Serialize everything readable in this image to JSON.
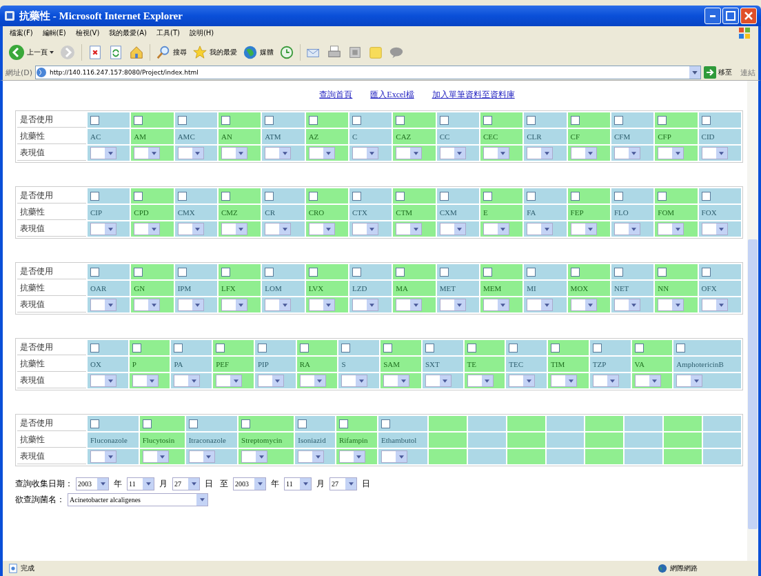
{
  "window": {
    "title": "抗藥性 - Microsoft Internet Explorer"
  },
  "menu": [
    "檔案(F)",
    "編輯(E)",
    "檢視(V)",
    "我的最愛(A)",
    "工具(T)",
    "說明(H)"
  ],
  "toolbar": {
    "back": "上一頁",
    "search": "搜尋",
    "favorites": "我的最愛",
    "media": "媒體"
  },
  "address": {
    "label": "網址(D)",
    "url": "http://140.116.247.157:8080/Project/index.html",
    "go": "移至",
    "links": "連結"
  },
  "nav_links": [
    "查詢首頁",
    "匯入Excel檔",
    "加入單筆資料至資料庫"
  ],
  "tables": [
    {
      "labels": [
        "是否使用",
        "抗藥性",
        "表現值"
      ],
      "columns": [
        {
          "kind": "drug",
          "name": "AC",
          "checked": false
        },
        {
          "kind": "drug",
          "name": "AM",
          "checked": false
        },
        {
          "kind": "drug",
          "name": "AMC",
          "checked": false
        },
        {
          "kind": "drug",
          "name": "AN",
          "checked": false
        },
        {
          "kind": "drug",
          "name": "ATM",
          "checked": false
        },
        {
          "kind": "drug",
          "name": "AZ",
          "checked": false
        },
        {
          "kind": "drug",
          "name": "C",
          "checked": false
        },
        {
          "kind": "drug",
          "name": "CAZ",
          "checked": false
        },
        {
          "kind": "drug",
          "name": "CC",
          "checked": false
        },
        {
          "kind": "drug",
          "name": "CEC",
          "checked": false
        },
        {
          "kind": "drug",
          "name": "CLR",
          "checked": false
        },
        {
          "kind": "drug",
          "name": "CF",
          "checked": false
        },
        {
          "kind": "drug",
          "name": "CFM",
          "checked": false
        },
        {
          "kind": "drug",
          "name": "CFP",
          "checked": false
        },
        {
          "kind": "drug",
          "name": "CID",
          "checked": false
        }
      ]
    },
    {
      "labels": [
        "是否使用",
        "抗藥性",
        "表現值"
      ],
      "columns": [
        {
          "kind": "drug",
          "name": "CIP",
          "checked": false
        },
        {
          "kind": "drug",
          "name": "CPD",
          "checked": false
        },
        {
          "kind": "drug",
          "name": "CMX",
          "checked": false
        },
        {
          "kind": "drug",
          "name": "CMZ",
          "checked": false
        },
        {
          "kind": "drug",
          "name": "CR",
          "checked": false
        },
        {
          "kind": "drug",
          "name": "CRO",
          "checked": false
        },
        {
          "kind": "drug",
          "name": "CTX",
          "checked": false
        },
        {
          "kind": "drug",
          "name": "CTM",
          "checked": false
        },
        {
          "kind": "drug",
          "name": "CXM",
          "checked": false
        },
        {
          "kind": "drug",
          "name": "E",
          "checked": false
        },
        {
          "kind": "drug",
          "name": "FA",
          "checked": false
        },
        {
          "kind": "drug",
          "name": "FEP",
          "checked": false
        },
        {
          "kind": "drug",
          "name": "FLO",
          "checked": false
        },
        {
          "kind": "drug",
          "name": "FOM",
          "checked": false
        },
        {
          "kind": "drug",
          "name": "FOX",
          "checked": false
        }
      ]
    },
    {
      "labels": [
        "是否使用",
        "抗藥性",
        "表現值"
      ],
      "columns": [
        {
          "kind": "drug",
          "name": "OAR",
          "checked": false
        },
        {
          "kind": "drug",
          "name": "GN",
          "checked": false
        },
        {
          "kind": "drug",
          "name": "IPM",
          "checked": false
        },
        {
          "kind": "drug",
          "name": "LFX",
          "checked": false
        },
        {
          "kind": "drug",
          "name": "LOM",
          "checked": false
        },
        {
          "kind": "drug",
          "name": "LVX",
          "checked": false
        },
        {
          "kind": "drug",
          "name": "LZD",
          "checked": false
        },
        {
          "kind": "drug",
          "name": "MA",
          "checked": false
        },
        {
          "kind": "drug",
          "name": "MET",
          "checked": false
        },
        {
          "kind": "drug",
          "name": "MEM",
          "checked": false
        },
        {
          "kind": "drug",
          "name": "MI",
          "checked": false
        },
        {
          "kind": "drug",
          "name": "MOX",
          "checked": false
        },
        {
          "kind": "drug",
          "name": "NET",
          "checked": false
        },
        {
          "kind": "drug",
          "name": "NN",
          "checked": false
        },
        {
          "kind": "drug",
          "name": "OFX",
          "checked": false
        }
      ]
    },
    {
      "labels": [
        "是否使用",
        "抗藥性",
        "表現值"
      ],
      "columns": [
        {
          "kind": "drug",
          "name": "OX",
          "checked": false
        },
        {
          "kind": "drug",
          "name": "P",
          "checked": false
        },
        {
          "kind": "drug",
          "name": "PA",
          "checked": false
        },
        {
          "kind": "drug",
          "name": "PEF",
          "checked": false
        },
        {
          "kind": "drug",
          "name": "PIP",
          "checked": false
        },
        {
          "kind": "drug",
          "name": "RA",
          "checked": false
        },
        {
          "kind": "drug",
          "name": "S",
          "checked": false
        },
        {
          "kind": "drug",
          "name": "SAM",
          "checked": false
        },
        {
          "kind": "drug",
          "name": "SXT",
          "checked": false
        },
        {
          "kind": "drug",
          "name": "TE",
          "checked": false
        },
        {
          "kind": "drug",
          "name": "TEC",
          "checked": false
        },
        {
          "kind": "drug",
          "name": "TIM",
          "checked": false
        },
        {
          "kind": "drug",
          "name": "TZP",
          "checked": false
        },
        {
          "kind": "drug",
          "name": "VA",
          "checked": false
        },
        {
          "kind": "drug",
          "name": "AmphotericinB",
          "checked": false
        }
      ]
    },
    {
      "labels": [
        "是否使用",
        "抗藥性",
        "表現值"
      ],
      "columns": [
        {
          "kind": "drug",
          "name": "Fluconazole",
          "checked": false
        },
        {
          "kind": "drug",
          "name": "Flucytosin",
          "checked": false
        },
        {
          "kind": "drug",
          "name": "Itraconazole",
          "checked": false
        },
        {
          "kind": "drug",
          "name": "Streptomycin",
          "checked": false
        },
        {
          "kind": "drug",
          "name": "Isoniazid",
          "checked": false
        },
        {
          "kind": "drug",
          "name": "Rifampin",
          "checked": false
        },
        {
          "kind": "drug",
          "name": "Ethambutol",
          "checked": false
        },
        {
          "kind": "blank"
        },
        {
          "kind": "blank"
        },
        {
          "kind": "blank"
        },
        {
          "kind": "blank"
        },
        {
          "kind": "blank"
        },
        {
          "kind": "blank"
        },
        {
          "kind": "blank"
        },
        {
          "kind": "blank"
        }
      ]
    }
  ],
  "date_filter": {
    "label": "查詢收集日期：",
    "from": {
      "year": "2003",
      "year_unit": "年",
      "month": "11",
      "month_unit": "月",
      "day": "27",
      "day_unit": "日"
    },
    "separator": "至",
    "to": {
      "year": "2003",
      "year_unit": "年",
      "month": "11",
      "month_unit": "月",
      "day": "27",
      "day_unit": "日"
    }
  },
  "bacteria": {
    "label": "欲查詢菌名：",
    "value": "Acinetobacter alcaligenes"
  },
  "status_bar": {
    "text": "完成",
    "zone": "網際網路"
  }
}
